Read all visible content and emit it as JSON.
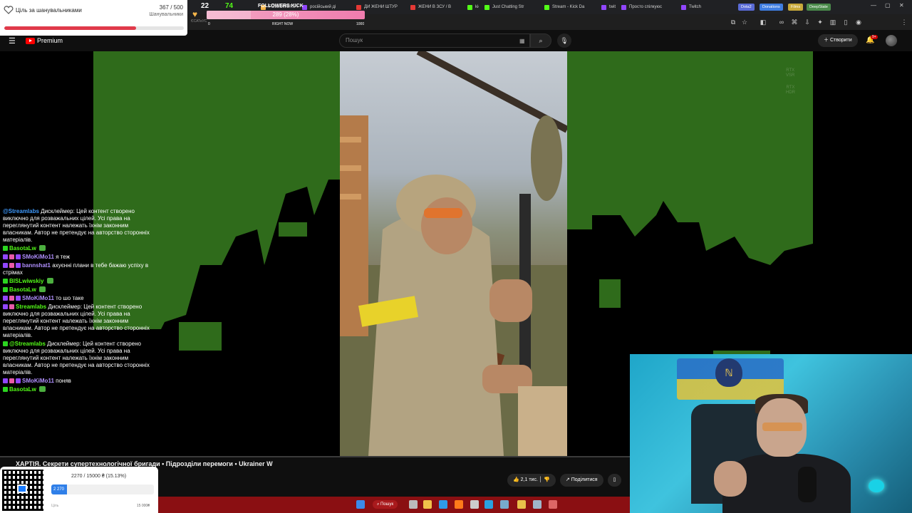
{
  "browser": {
    "tabs": [
      {
        "label": "FOLLOWERS KICK",
        "color": "#f5b64a"
      },
      {
        "label": "російський ді",
        "color": "#9146ff"
      },
      {
        "label": "ДИ ЖЕНИ ШТУР",
        "color": "#e53935"
      },
      {
        "label": "ЖЕНИ В ЗСУ / В",
        "color": "#e53935"
      },
      {
        "label": "kick",
        "color": "#53fc18"
      },
      {
        "label": "Just Chatting Str",
        "color": "#53fc18"
      },
      {
        "label": "Stream - Kick Da",
        "color": "#53fc18"
      },
      {
        "label": "twitch",
        "color": "#9146ff"
      },
      {
        "label": "Просто спілкуюс",
        "color": "#9146ff"
      },
      {
        "label": "Twitch",
        "color": "#9146ff"
      }
    ],
    "bookmarks": [
      {
        "label": "Dota2",
        "color": "#5a6bd6"
      },
      {
        "label": "Donations",
        "color": "#3f7de0"
      },
      {
        "label": "Films",
        "color": "#c8a93a"
      },
      {
        "label": "DeepState",
        "color": "#4a8a4a"
      }
    ],
    "window_controls": [
      "—",
      "▢",
      "✕"
    ],
    "address_text": "ЄСАТеУС"
  },
  "goal": {
    "title": "Ціль за шанувальниками",
    "count": "367 / 500",
    "subtitle": "Шанувальники",
    "progress": 0.734
  },
  "kick_widget": {
    "stat1": "22",
    "stat2": "74",
    "followers_label": "FOLLOWERS KICK",
    "bar_text": "289 (28%)",
    "bar_progress": 0.28,
    "tick_start": "0",
    "tick_mid": "RIGHT NOW",
    "tick_end": "1000"
  },
  "youtube": {
    "brand": "Premium",
    "search_placeholder": "Пошук",
    "create_label": "Створити",
    "notification_count": "9+",
    "video_title": "ХАРТІЯ. Секрети супертехнологічної бригади • Підрозділи перемоги • Ukrainer W",
    "likes_label": "2,1 тис.",
    "share_label": "Поділитися",
    "rtx_top": [
      "RTX",
      "VSR"
    ],
    "rtx_bottom": [
      "RTX",
      "HDR"
    ]
  },
  "chat": [
    {
      "user": "@Streamlabs",
      "ucls": "u-blue",
      "badges": [],
      "text": "Дисклеймер: Цей контент створено виключно для розважальних цілей. Усі права на переглянутий контент належать їхнім законним власникам. Автор не претендує на авторство сторонніх матеріалів."
    },
    {
      "user": "BasotaLw",
      "ucls": "u-kick",
      "badges": [
        "b-kick"
      ],
      "text": "",
      "emote": true
    },
    {
      "user": "SMoKiMo11",
      "ucls": "u-purple",
      "badges": [
        "b-purple",
        "b-pink",
        "b-purple"
      ],
      "text": "я теж"
    },
    {
      "user": "bannshat1",
      "ucls": "u-purple",
      "badges": [
        "b-purple",
        "b-pink",
        "b-purple"
      ],
      "text": "ахуєнні плани в тебе бажаю успіху в стрімах"
    },
    {
      "user": "BISLwiwskiy",
      "ucls": "u-kick",
      "badges": [
        "b-kick"
      ],
      "text": "",
      "emote": true
    },
    {
      "user": "BasotaLw",
      "ucls": "u-kick",
      "badges": [
        "b-kick"
      ],
      "text": "",
      "emote": true
    },
    {
      "user": "SMoKiMo11",
      "ucls": "u-purple",
      "badges": [
        "b-purple",
        "b-pink",
        "b-purple"
      ],
      "text": "то шо таке"
    },
    {
      "user": "Streamlabs",
      "ucls": "u-kick",
      "badges": [
        "b-purple",
        "b-pink"
      ],
      "text": "Дисклеймер: Цей контент створено виключно для розважальних цілей. Усі права на переглянутий контент належать їхнім законним власникам. Автор не претендує на авторство сторонніх матеріалів."
    },
    {
      "user": "@Streamlabs",
      "ucls": "u-kick",
      "badges": [
        "b-kick"
      ],
      "text": "Дисклеймер: Цей контент створено виключно для розважальних цілей. Усі права на переглянутий контент належать їхнім законним власникам. Автор не претендує на авторство сторонніх матеріалів."
    },
    {
      "user": "SMoKiMo11",
      "ucls": "u-purple",
      "badges": [
        "b-purple",
        "b-pink",
        "b-purple"
      ],
      "text": "поняв"
    },
    {
      "user": "BasotaLw",
      "ucls": "u-kick",
      "badges": [
        "b-kick"
      ],
      "text": "",
      "emote": true
    }
  ],
  "donation": {
    "amount_text": "2270 / 15000 ₴ (15.13%)",
    "bar_label": "2 270",
    "progress": 0.1513,
    "left_label": "Ціль",
    "right_label": "15 000₴"
  },
  "taskbar": {
    "search_label": "Пошук",
    "icons": [
      {
        "name": "windows-start-icon",
        "color": "#3b8bea"
      },
      {
        "name": "task-view-icon",
        "color": "#bbbbbb"
      },
      {
        "name": "file-explorer-icon",
        "color": "#f0c24a"
      },
      {
        "name": "browser-icon",
        "color": "#2f9be8"
      },
      {
        "name": "firefox-icon",
        "color": "#ff7a1a"
      },
      {
        "name": "obs-icon",
        "color": "#cccccc"
      },
      {
        "name": "telegram-icon",
        "color": "#2aa1e0"
      },
      {
        "name": "app-icon",
        "color": "#77aacc"
      },
      {
        "name": "chrome-icon",
        "color": "#e8c04a"
      },
      {
        "name": "steam-icon",
        "color": "#9fb6c9"
      },
      {
        "name": "app2-icon",
        "color": "#d66"
      }
    ]
  }
}
